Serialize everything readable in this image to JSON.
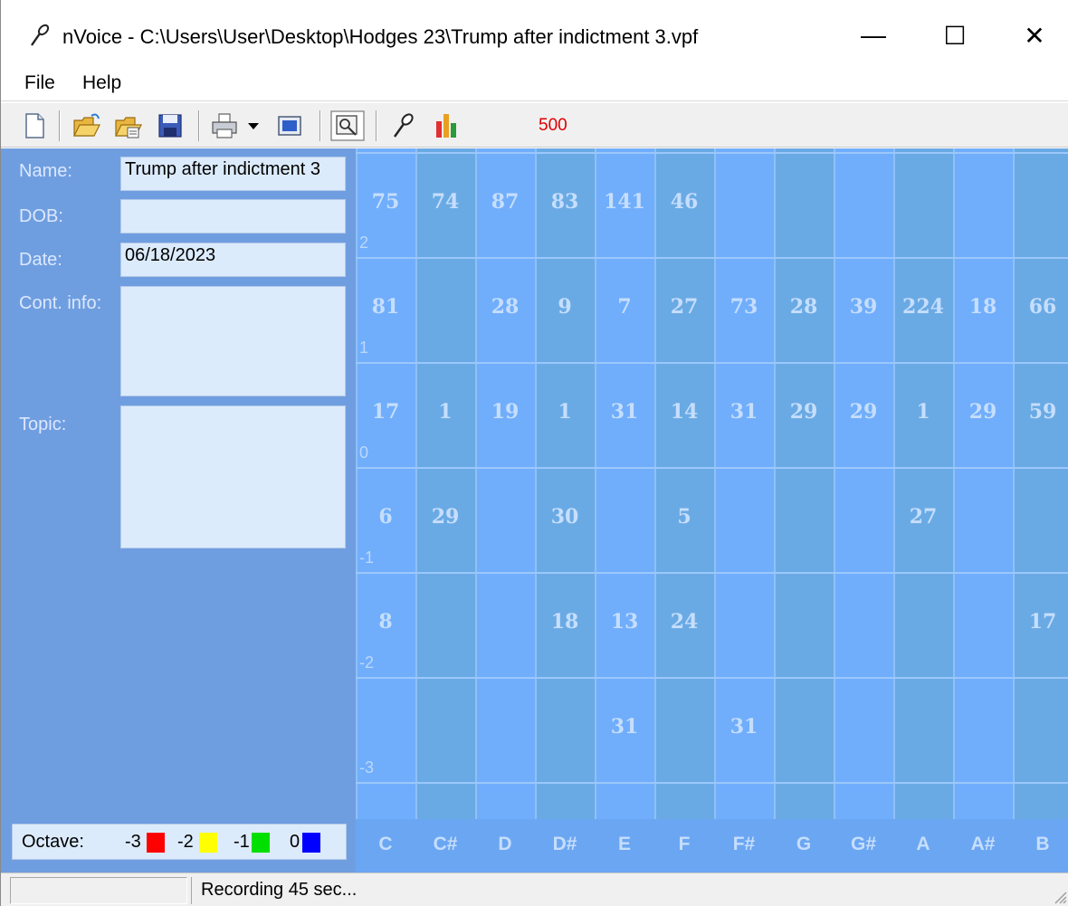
{
  "window": {
    "title": "nVoice - C:\\Users\\User\\Desktop\\Hodges 23\\Trump after indictment 3.vpf",
    "minimize_glyph": "—",
    "maximize_glyph": "☐",
    "close_glyph": "✕"
  },
  "menu": {
    "file": "File",
    "help": "Help"
  },
  "toolbar": {
    "icons": [
      "new-document-icon",
      "open-folder-icon",
      "open-folder-recent-icon",
      "save-icon",
      "print-icon",
      "print-dropdown-icon",
      "display-icon",
      "record-settings-icon",
      "microphone-icon",
      "bar-chart-icon"
    ],
    "count": "500",
    "count_color": "#e00000"
  },
  "form": {
    "name_label": "Name:",
    "name_value": "Trump after indictment 3",
    "dob_label": "DOB:",
    "dob_value": "",
    "date_label": "Date:",
    "date_value": "06/18/2023",
    "contact_label": "Cont. info:",
    "contact_value": "",
    "topic_label": "Topic:",
    "topic_value": ""
  },
  "legend": {
    "label": "Octave:",
    "items": [
      {
        "value": "-3",
        "color": "#ff0000"
      },
      {
        "value": "-2",
        "color": "#ffff00"
      },
      {
        "value": "-1",
        "color": "#00e000"
      },
      {
        "value": "0",
        "color": "#0000ff"
      }
    ]
  },
  "grid": {
    "notes": [
      "C",
      "C#",
      "D",
      "D#",
      "E",
      "F",
      "F#",
      "G",
      "G#",
      "A",
      "A#",
      "B"
    ],
    "rows": [
      {
        "octave": "2",
        "values": [
          "75",
          "74",
          "87",
          "83",
          "141",
          "46",
          "",
          "",
          "",
          "",
          "",
          ""
        ]
      },
      {
        "octave": "1",
        "values": [
          "81",
          "",
          "28",
          "9",
          "7",
          "27",
          "73",
          "28",
          "39",
          "224",
          "18",
          "66"
        ]
      },
      {
        "octave": "0",
        "values": [
          "17",
          "1",
          "19",
          "1",
          "31",
          "14",
          "31",
          "29",
          "29",
          "1",
          "29",
          "59"
        ]
      },
      {
        "octave": "-1",
        "values": [
          "6",
          "29",
          "",
          "30",
          "",
          "5",
          "",
          "",
          "",
          "27",
          "",
          ""
        ]
      },
      {
        "octave": "-2",
        "values": [
          "8",
          "",
          "",
          "18",
          "13",
          "24",
          "",
          "",
          "",
          "",
          "",
          "17"
        ]
      },
      {
        "octave": "-3",
        "values": [
          "",
          "",
          "",
          "",
          "31",
          "",
          "31",
          "",
          "",
          "",
          "",
          ""
        ]
      }
    ]
  },
  "status": {
    "message": "Recording 45 sec..."
  }
}
